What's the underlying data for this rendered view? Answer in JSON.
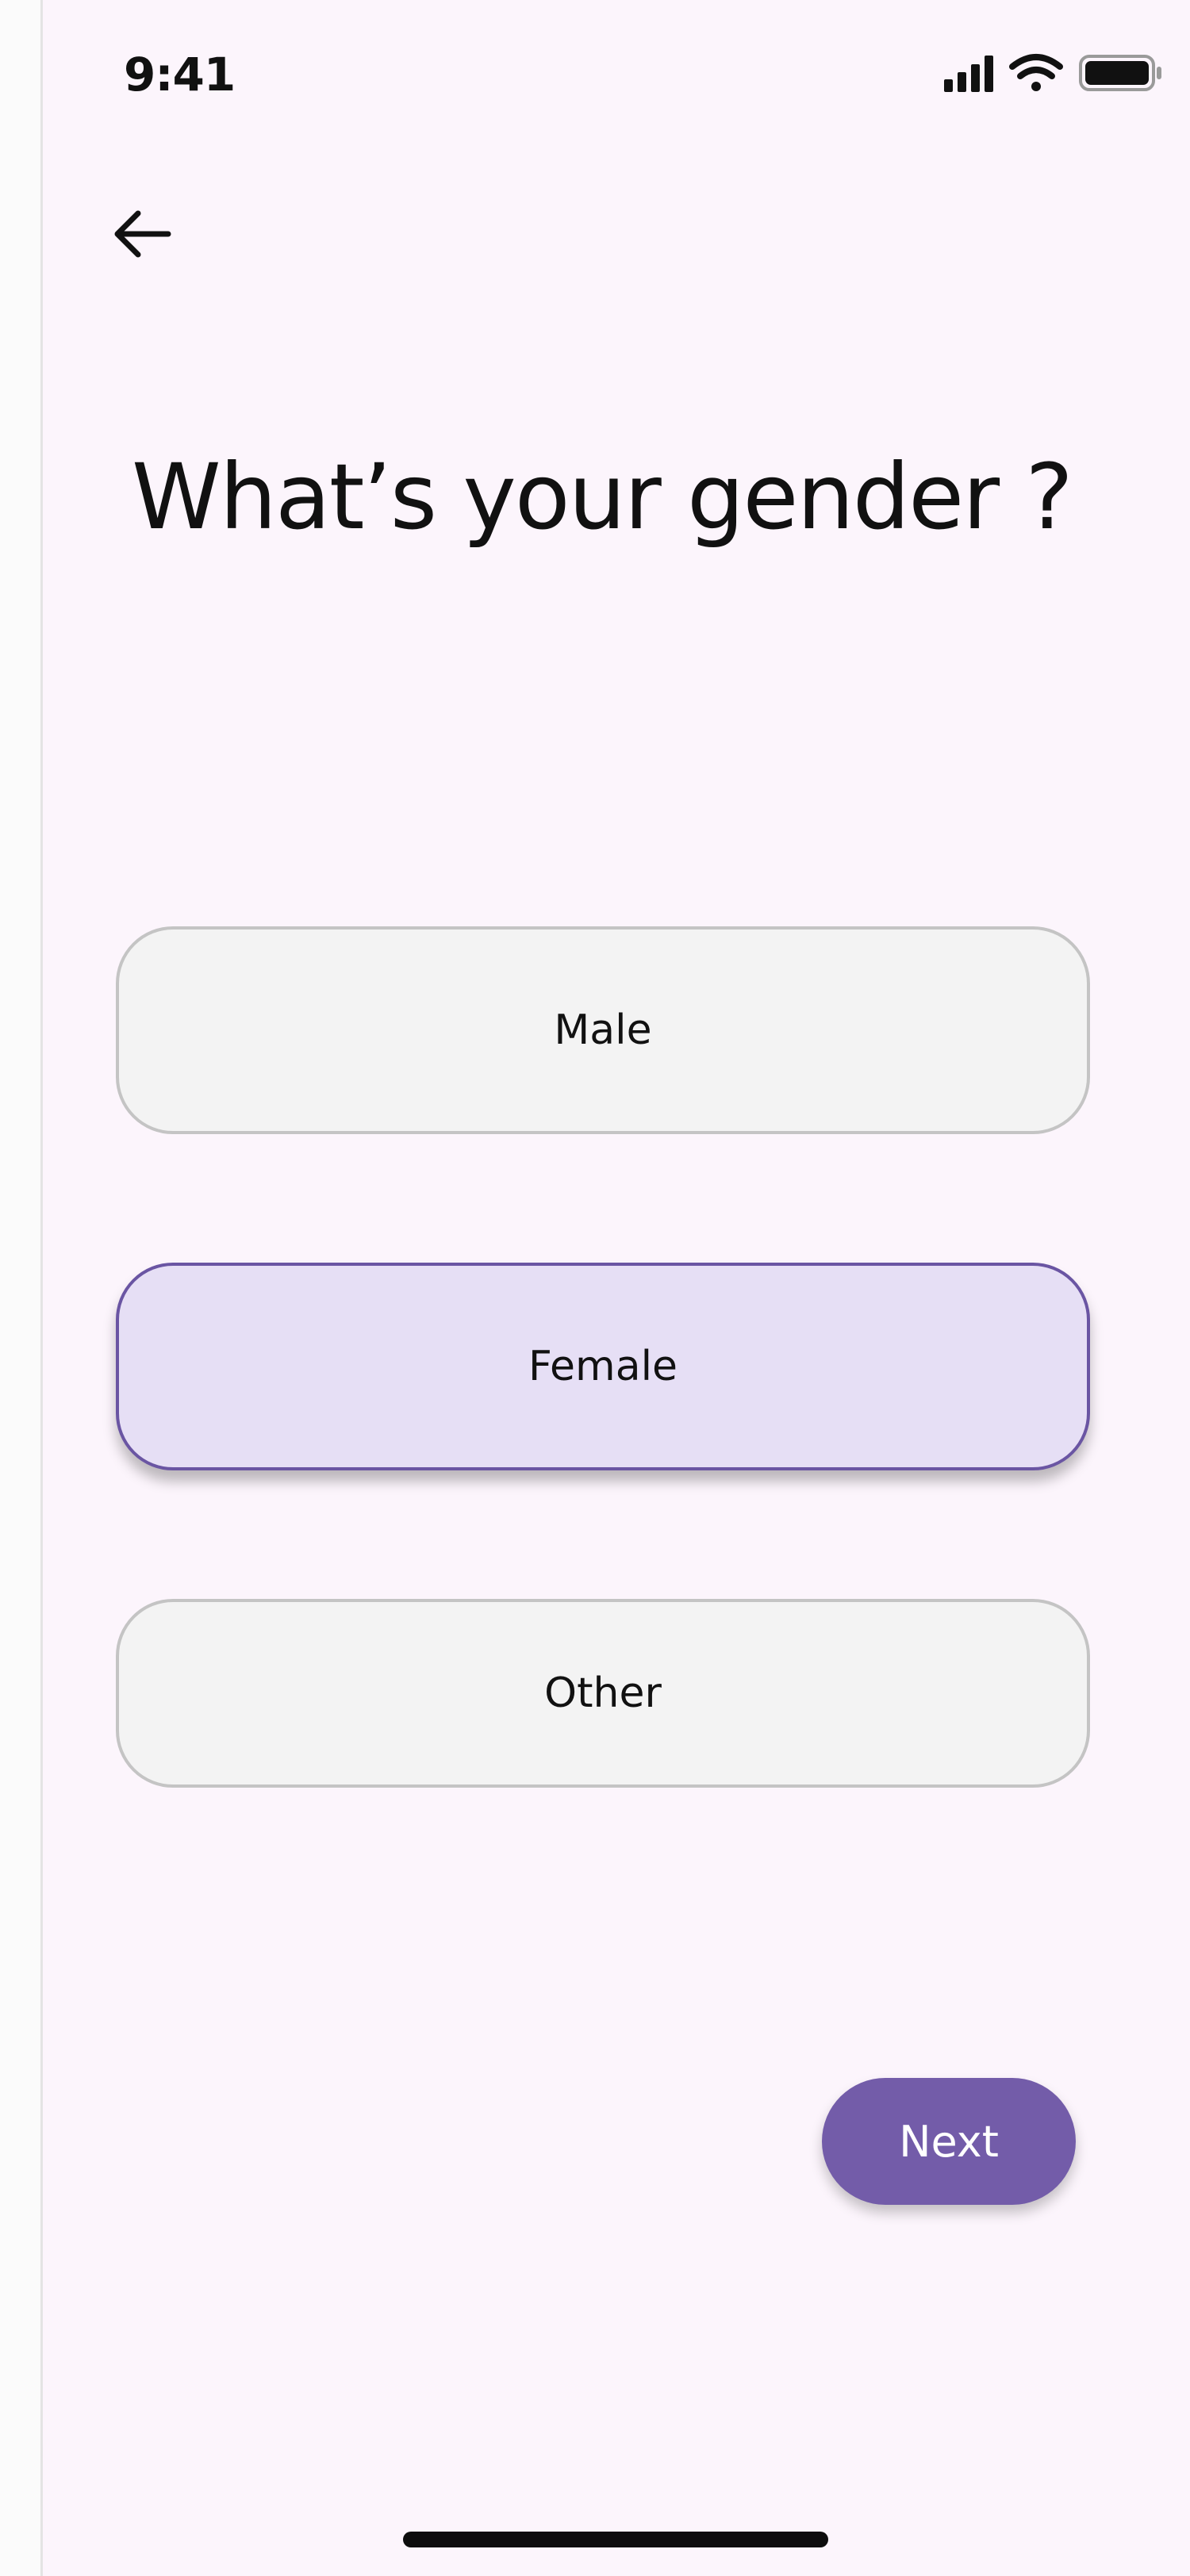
{
  "status_bar": {
    "time": "9:41",
    "icons": [
      "signal-icon",
      "wifi-icon",
      "battery-icon"
    ]
  },
  "header": {
    "back_icon": "arrow-left-icon"
  },
  "title": "What’s your gender ?",
  "options": [
    {
      "label": "Male",
      "selected": false
    },
    {
      "label": "Female",
      "selected": true
    },
    {
      "label": "Other",
      "selected": false
    }
  ],
  "next_label": "Next",
  "colors": {
    "background": "#fcf5fc",
    "accent": "#735ca9",
    "selected_fill": "#e6dff5",
    "selected_border": "#6a55a3",
    "option_fill": "#f3f3f3",
    "option_border": "#c4c4c4"
  }
}
